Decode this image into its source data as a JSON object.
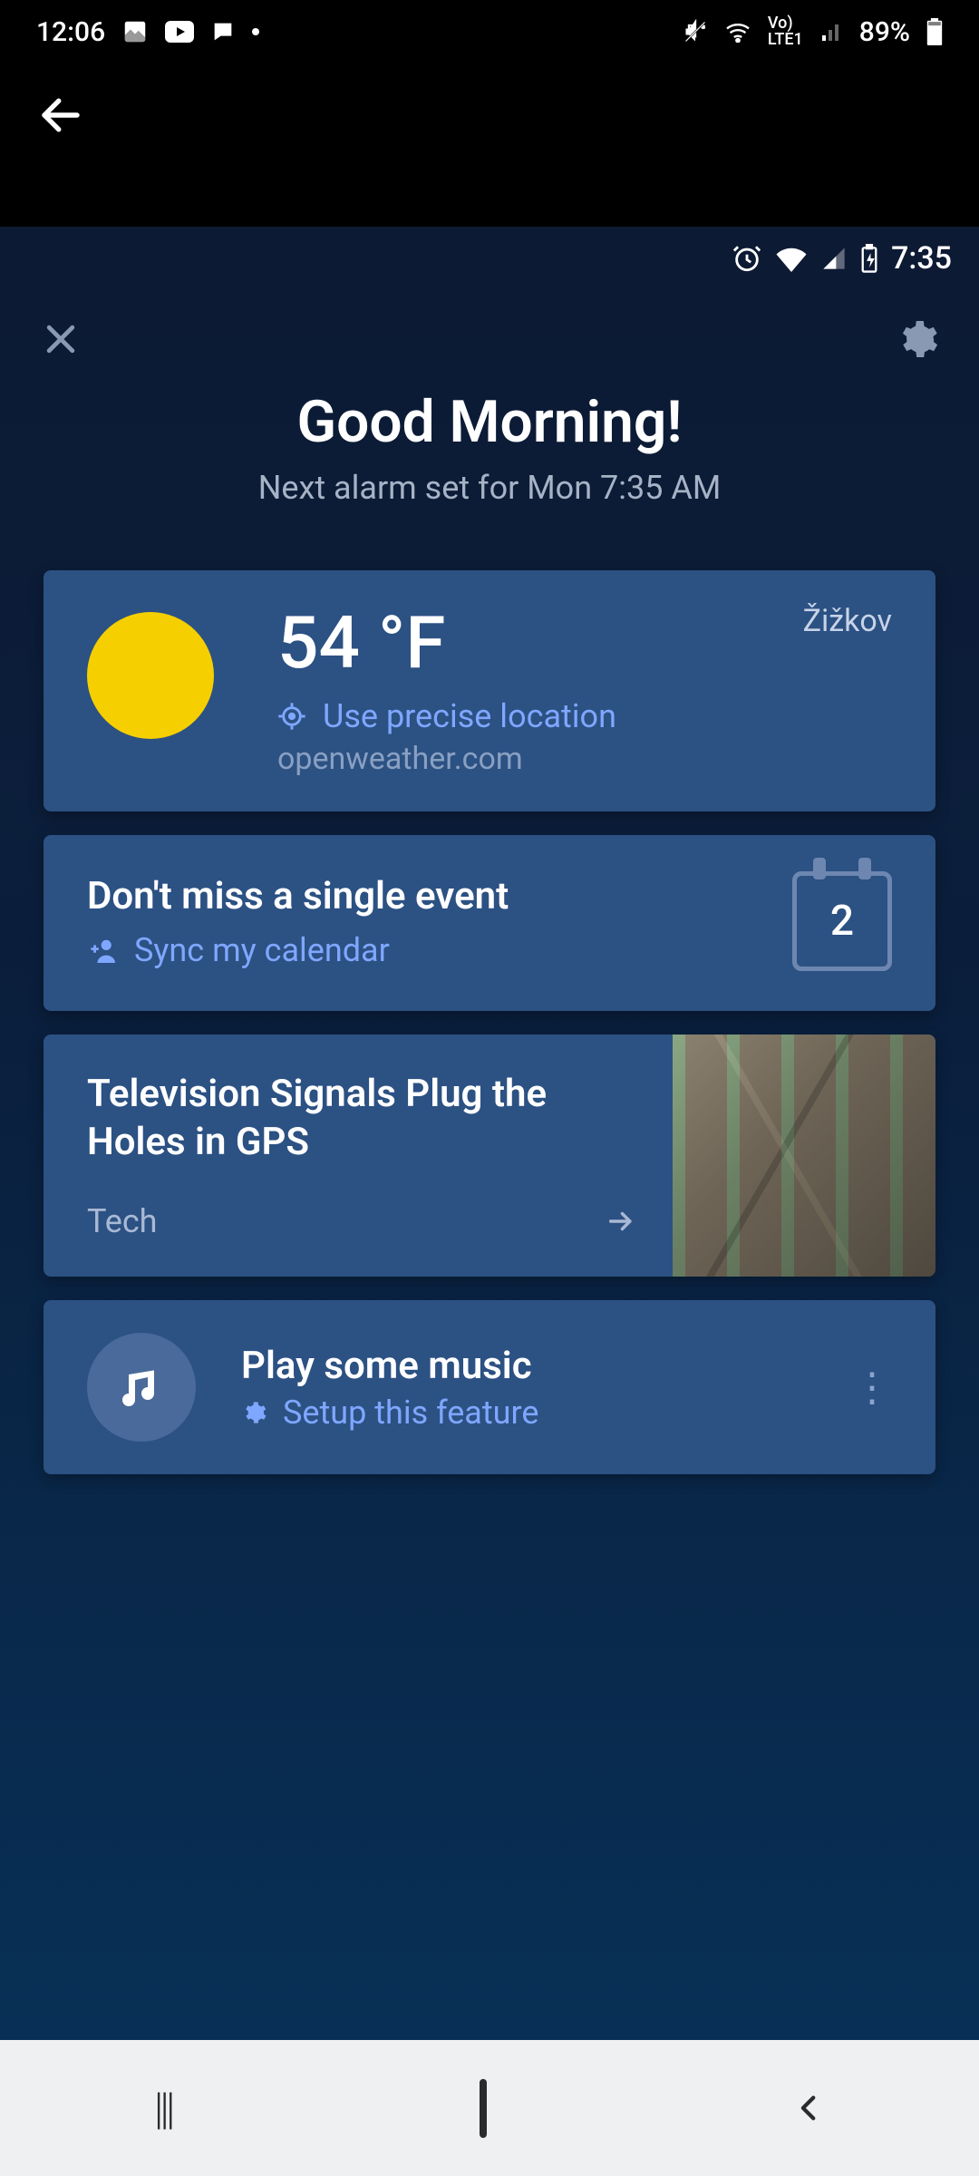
{
  "outer_status": {
    "time": "12:06",
    "battery": "89%"
  },
  "inner_status": {
    "time": "7:35"
  },
  "greeting": {
    "title": "Good Morning!",
    "subtitle": "Next alarm set for Mon 7:35 AM"
  },
  "weather": {
    "temperature": "54 °F",
    "precise_link": "Use precise location",
    "source": "openweather.com",
    "location": "Žižkov"
  },
  "calendar": {
    "title": "Don't miss a single event",
    "action": "Sync my calendar",
    "day_badge": "2"
  },
  "news": {
    "headline": "Television Signals Plug the Holes in GPS",
    "category": "Tech"
  },
  "music": {
    "title": "Play some music",
    "action": "Setup this feature"
  }
}
